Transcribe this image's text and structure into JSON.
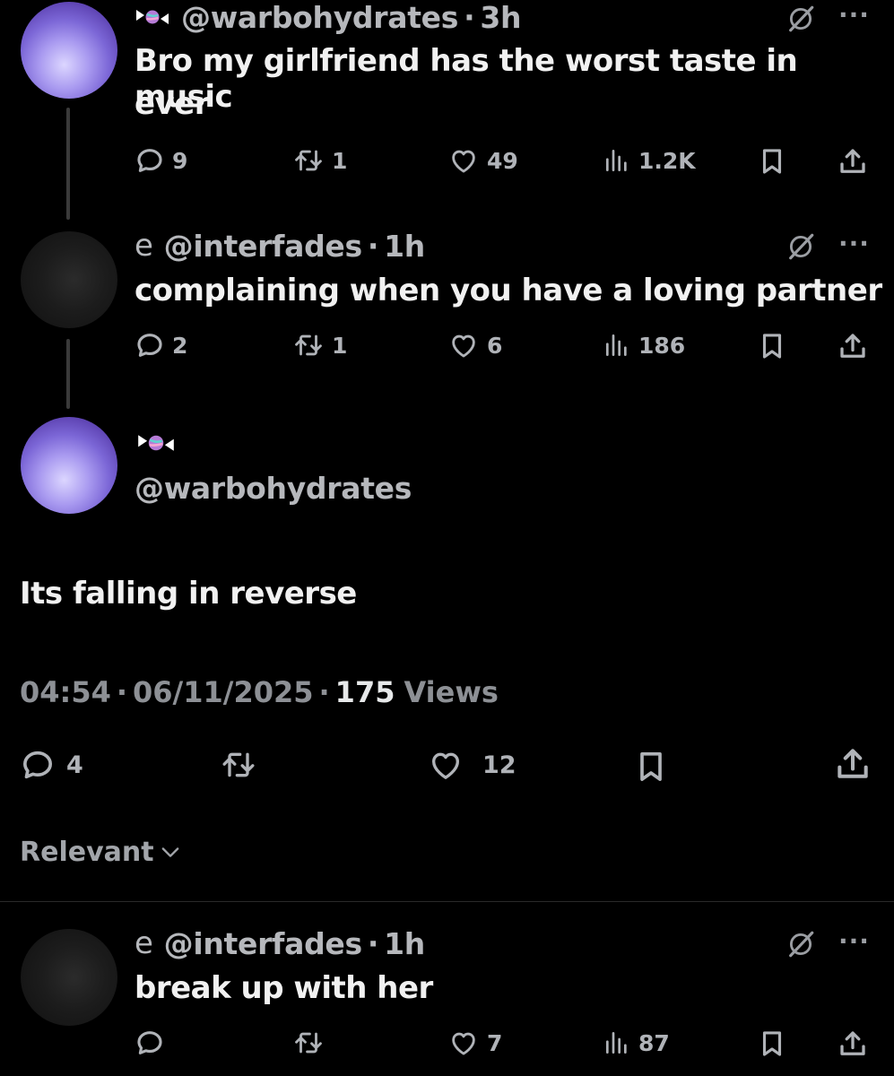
{
  "tweet1": {
    "handle": "@warbohydrates",
    "sep": "·",
    "time": "3h",
    "text_line1": "Bro my girlfriend has the worst taste in music",
    "text_line2": "ever",
    "replies": "9",
    "reposts": "1",
    "likes": "49",
    "views": "1.2K"
  },
  "tweet2": {
    "handle": "@interfades",
    "sep": "·",
    "time": "1h",
    "text": "complaining when you have a loving partner",
    "replies": "2",
    "reposts": "1",
    "likes": "6",
    "views": "186"
  },
  "main_tweet": {
    "handle": "@warbohydrates",
    "text": "Its falling in reverse",
    "time": "04:54",
    "date": "06/11/2025",
    "views_count": "175",
    "views_label": "Views",
    "sep": "·",
    "replies": "4",
    "likes": "12"
  },
  "sort": {
    "label": "Relevant"
  },
  "reply1": {
    "handle": "@interfades",
    "sep": "·",
    "time": "1h",
    "text": "break up with her",
    "likes": "7",
    "views": "87"
  },
  "menu_glyph": "···",
  "icons": [
    "candy-icon",
    "e-icon",
    "grok-icon",
    "more-icon",
    "reply-icon",
    "repost-icon",
    "like-icon",
    "views-icon",
    "bookmark-icon",
    "share-icon",
    "chevron-down-icon"
  ],
  "colors": {
    "background": "#000000",
    "text": "#e7e9ea",
    "muted": "#b0b3b8"
  }
}
